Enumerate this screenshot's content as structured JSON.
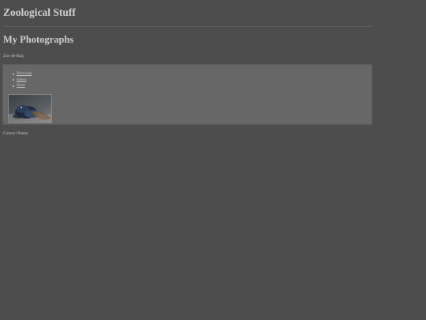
{
  "site": {
    "title": "Zoological Stuff"
  },
  "page": {
    "heading": "My Photographs",
    "caption": "Zoo de Baq"
  },
  "photo_nav": {
    "items": [
      {
        "label": "Previous"
      },
      {
        "label": "Index"
      },
      {
        "label": "Next"
      }
    ]
  },
  "photo": {
    "thumbnail_icon": "photo-thumbnail-icon"
  },
  "footer": {
    "contact": "Contact Name"
  },
  "colors": {
    "background": "#4d4d4d",
    "panel": "#676767",
    "text": "#cccccc"
  }
}
